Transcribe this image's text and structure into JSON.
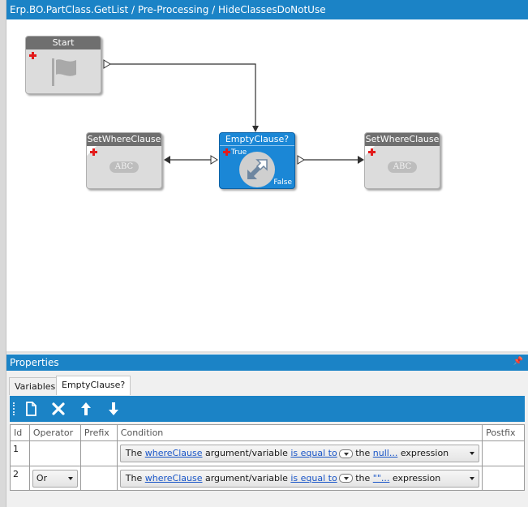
{
  "window": {
    "title": "Erp.BO.PartClass.GetList / Pre-Processing / HideClassesDoNotUse"
  },
  "workflow": {
    "start": {
      "label": "Start",
      "icon": "flag-icon"
    },
    "set_where_left": {
      "label": "SetWhereClause",
      "badge": "ABC"
    },
    "condition": {
      "label": "EmptyClause?",
      "true_label": "True",
      "false_label": "False",
      "icon": "condition-arrows-icon"
    },
    "set_where_right": {
      "label": "SetWhereClause",
      "badge": "ABC"
    }
  },
  "properties": {
    "title": "Properties",
    "pin_icon": "pin-icon",
    "tabs": [
      {
        "label": "Variables",
        "active": false
      },
      {
        "label": "EmptyClause?",
        "active": true
      }
    ],
    "toolbar": {
      "icons": [
        "new-document-icon",
        "delete-icon",
        "move-up-icon",
        "move-down-icon"
      ]
    },
    "grid": {
      "columns": [
        "Id",
        "Operator",
        "Prefix",
        "Condition",
        "Postfix"
      ],
      "rows": [
        {
          "id": "1",
          "operator": "",
          "prefix": "",
          "condition": {
            "pre": "The",
            "variable": "whereClause",
            "mid": "argument/variable",
            "comparison": "is equal to",
            "the": "the",
            "value": "null...",
            "post": "expression"
          },
          "postfix": ""
        },
        {
          "id": "2",
          "operator": "Or",
          "prefix": "",
          "condition": {
            "pre": "The",
            "variable": "whereClause",
            "mid": "argument/variable",
            "comparison": "is equal to",
            "the": "the",
            "value": "\"\"...",
            "post": "expression"
          },
          "postfix": ""
        }
      ]
    }
  },
  "colors": {
    "accent": "#1b83c6",
    "node_gray": "#dcdcdc",
    "node_blue": "#1b87d6",
    "plus_red": "#e31b1b",
    "link": "#1a56c8"
  }
}
